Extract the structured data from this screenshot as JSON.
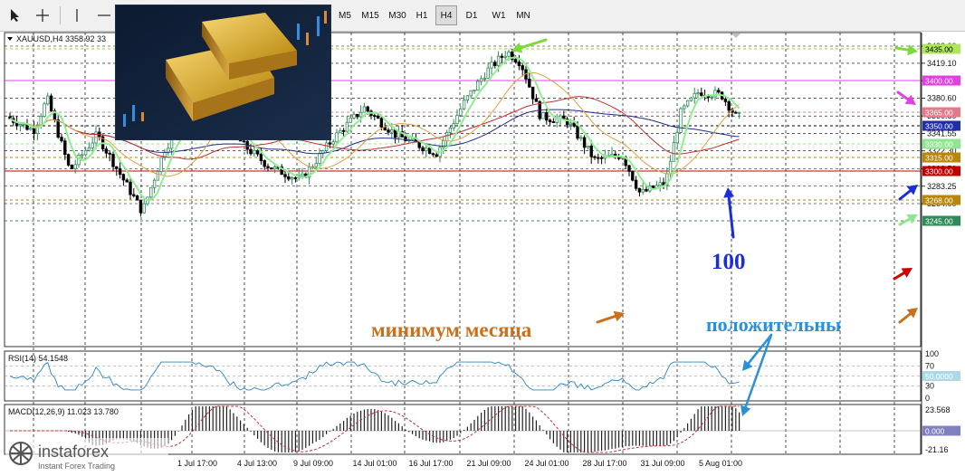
{
  "toolbar": {
    "tools": [
      "cursor-icon",
      "crosshair-icon",
      "vertical-line-icon",
      "horizontal-line-icon"
    ],
    "timeframes": [
      "M5",
      "M15",
      "M30",
      "H1",
      "H4",
      "D1",
      "W1",
      "MN"
    ],
    "active_timeframe": "H4"
  },
  "chart": {
    "symbol_info": "XAUUSD,H4  3358.92 33",
    "price_ticks": [
      "3438.00",
      "3419.10",
      "3399.85",
      "3380.60",
      "3360.80",
      "3341.55",
      "3322.30",
      "3302.50",
      "3283.25",
      "3264.00"
    ],
    "x_ticks": [
      "1 Jul 17:00",
      "4 Jul 13:00",
      "9 Jul 09:00",
      "14 Jul 01:00",
      "16 Jul 17:00",
      "21 Jul 09:00",
      "24 Jul 01:00",
      "28 Jul 17:00",
      "31 Jul 09:00",
      "5 Aug 01:00"
    ],
    "levels": [
      {
        "label": "3435.00",
        "bg": "#aee85a",
        "fg": "#000000",
        "line": "#9acd32"
      },
      {
        "label": "3400.00",
        "bg": "#e040e0",
        "fg": "#ffffff",
        "line": "#e040e0"
      },
      {
        "label": "3365.00",
        "bg": "#e37a8a",
        "fg": "#ffffff",
        "line": "#e37a8a"
      },
      {
        "label": "3350.00",
        "bg": "#1e2fa8",
        "fg": "#ffffff",
        "line": "#000000"
      },
      {
        "label": "3330.00",
        "bg": "#8fe68f",
        "fg": "#ffffff",
        "line": "#8fe68f"
      },
      {
        "label": "3315.00",
        "bg": "#b8860b",
        "fg": "#ffffff",
        "line": "#b8860b"
      },
      {
        "label": "3300.00",
        "bg": "#c00000",
        "fg": "#ffffff",
        "line": "#c00000"
      },
      {
        "label": "3268.00",
        "bg": "#b8860b",
        "fg": "#ffffff",
        "line": "#b8860b"
      },
      {
        "label": "3245.00",
        "bg": "#2e8b57",
        "fg": "#ffffff",
        "line": "#2e8b57"
      }
    ],
    "annotations": {
      "hundred": "100",
      "month_low": "минимум месяца",
      "positive": "положительны"
    },
    "colors": {
      "up": "#2e8b57",
      "down": "#000000",
      "ma_fast": "#90ee90",
      "ma_orange": "#e0a040",
      "ma_red": "#c03030",
      "ma_blue": "#1c2e8c"
    }
  },
  "rsi": {
    "label": "RSI(14) 54.1548",
    "ticks": [
      "100",
      "70",
      "30",
      "0"
    ],
    "level_label": "50.0000"
  },
  "macd": {
    "label": "MACD(12,26,9) 11.023 13.780",
    "ticks": [
      "23.568",
      "-21.16"
    ],
    "zero_label": "0.000"
  },
  "logo": {
    "brand": "instaforex",
    "tagline": "Instant Forex Trading"
  }
}
